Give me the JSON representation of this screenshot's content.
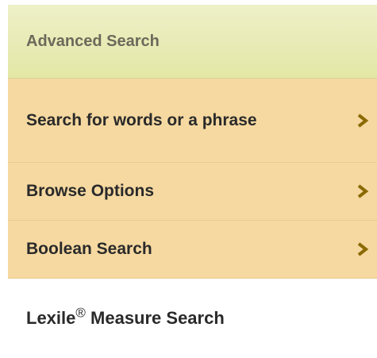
{
  "nav": {
    "header": "Advanced Search",
    "items": [
      {
        "label": "Search for words or a phrase",
        "icon": "chevron-right-icon"
      },
      {
        "label": "Browse Options",
        "icon": "chevron-right-icon"
      },
      {
        "label": "Boolean Search",
        "icon": "chevron-right-icon"
      }
    ],
    "lexile": {
      "prefix": "Lexile",
      "symbol": "®",
      "suffix": " Measure Search"
    }
  },
  "colors": {
    "header_bg": "#e6e9ad",
    "item_bg": "#f6d9a1",
    "chevron": "#8a6a00",
    "text": "#2a2a2a"
  }
}
